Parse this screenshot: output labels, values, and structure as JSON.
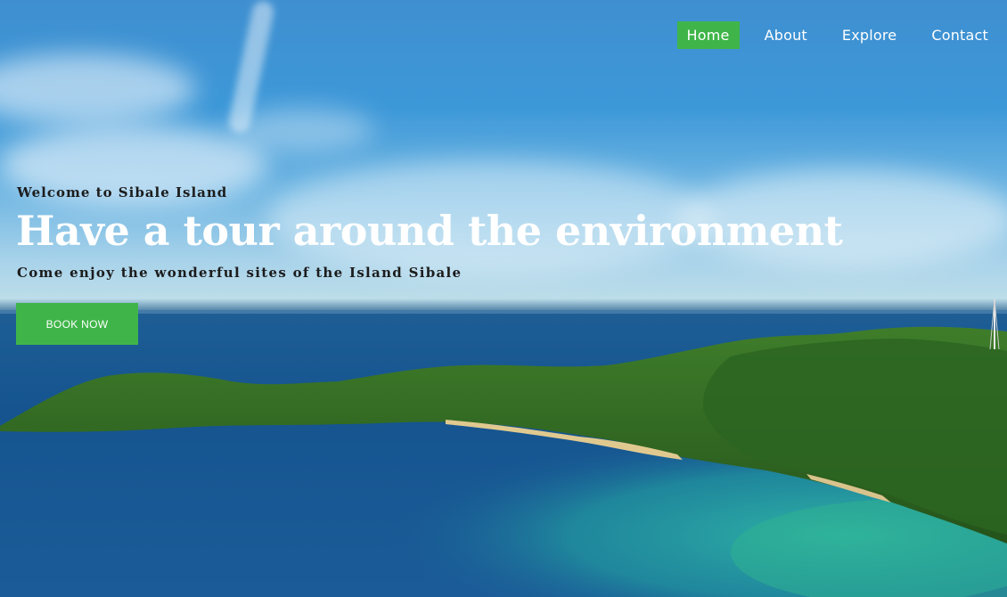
{
  "nav": {
    "items": [
      {
        "label": "Home",
        "active": true
      },
      {
        "label": "About",
        "active": false
      },
      {
        "label": "Explore",
        "active": false
      },
      {
        "label": "Contact",
        "active": false
      }
    ]
  },
  "hero": {
    "welcome": "Welcome to Sibale Island",
    "headline": "Have a tour around the environment",
    "subline": "Come enjoy the wonderful sites of the Island Sibale",
    "cta_label": "BOOK NOW"
  },
  "colors": {
    "accent": "#3fb549",
    "nav_text": "#ffffff",
    "dark_text": "#1c1c1c"
  }
}
